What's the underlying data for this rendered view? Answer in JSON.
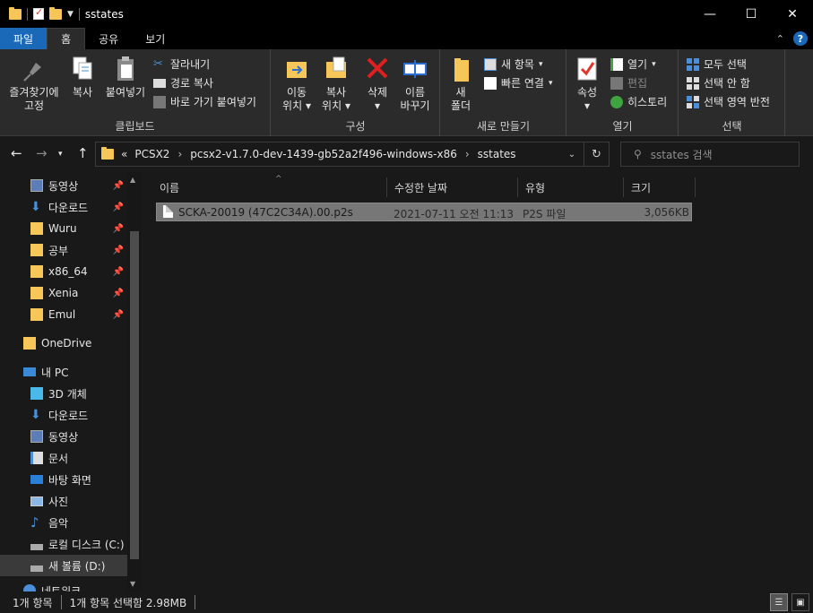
{
  "window": {
    "title": "sstates",
    "minimize": "—",
    "maximize": "☐",
    "close": "✕"
  },
  "tabs": [
    "파일",
    "홈",
    "공유",
    "보기"
  ],
  "ribbon": {
    "clipboard": {
      "label": "클립보드",
      "pin_line1": "즐겨찾기에",
      "pin_line2": "고정",
      "copy": "복사",
      "paste": "붙여넣기",
      "cut": "잘라내기",
      "copy_path": "경로 복사",
      "paste_shortcut": "바로 가기 붙여넣기"
    },
    "organize": {
      "label": "구성",
      "move_line1": "이동",
      "move_line2": "위치",
      "copy_line1": "복사",
      "copy_line2": "위치",
      "delete": "삭제",
      "rename_line1": "이름",
      "rename_line2": "바꾸기"
    },
    "new": {
      "label": "새로 만들기",
      "folder_line1": "새",
      "folder_line2": "폴더",
      "new_item": "새 항목",
      "easy_access": "빠른 연결"
    },
    "open": {
      "label": "열기",
      "properties": "속성",
      "open": "열기",
      "edit": "편집",
      "history": "히스토리"
    },
    "select": {
      "label": "선택",
      "select_all": "모두 선택",
      "select_none": "선택 안 함",
      "invert": "선택 영역 반전"
    }
  },
  "address": {
    "prefix": "«",
    "crumbs": [
      "PCSX2",
      "pcsx2-v1.7.0-dev-1439-gb52a2f496-windows-x86",
      "sstates"
    ],
    "search_placeholder": "sstates 검색"
  },
  "nav": {
    "quick": [
      "동영상",
      "다운로드",
      "Wuru",
      "공부",
      "x86_64",
      "Xenia",
      "Emul"
    ],
    "onedrive": "OneDrive",
    "thispc": "내 PC",
    "pc_items": [
      "3D 개체",
      "다운로드",
      "동영상",
      "문서",
      "바탕 화면",
      "사진",
      "음악",
      "로컬 디스크 (C:)",
      "새 볼륨 (D:)",
      "네트워크"
    ]
  },
  "columns": {
    "name": "이름",
    "modified": "수정한 날짜",
    "type": "유형",
    "size": "크기"
  },
  "files": [
    {
      "name": "SCKA-20019 (47C2C34A).00.p2s",
      "modified": "2021-07-11 오전 11:13",
      "type": "P2S 파일",
      "size": "3,056KB"
    }
  ],
  "status": {
    "count": "1개 항목",
    "selected": "1개 항목 선택함 2.98MB"
  }
}
